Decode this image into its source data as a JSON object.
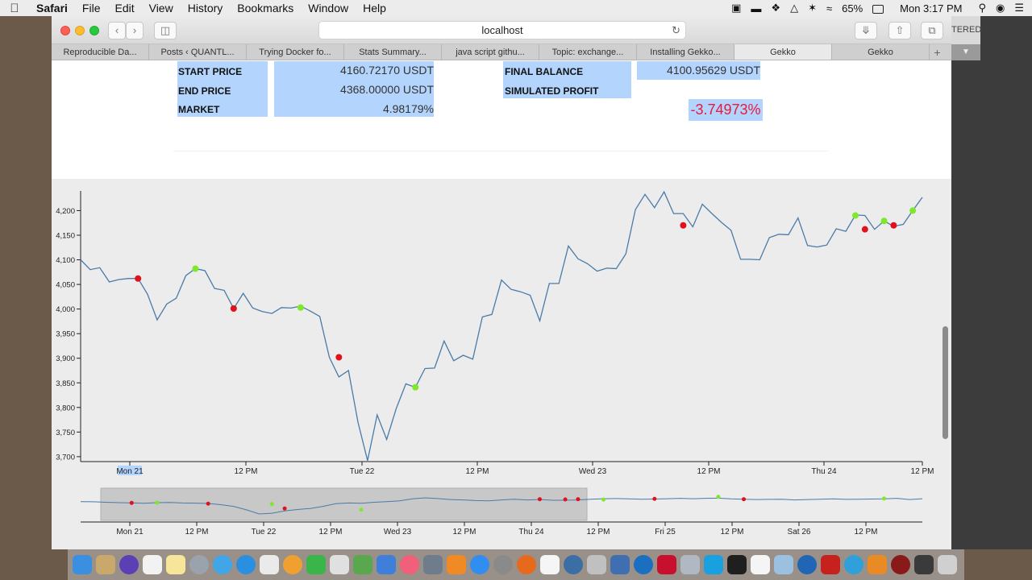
{
  "menubar": {
    "app": "Safari",
    "items": [
      "File",
      "Edit",
      "View",
      "History",
      "Bookmarks",
      "Window",
      "Help"
    ],
    "battery": "65%",
    "clock": "Mon 3:17 PM"
  },
  "browser": {
    "url": "localhost",
    "tabs": [
      "Reproducible Da...",
      "Posts ‹ QUANTL...",
      "Trying Docker fo...",
      "Stats Summary...",
      "java script githu...",
      "Topic: exchange...",
      "Installing Gekko...",
      "Gekko",
      "Gekko"
    ],
    "active_tab_index": 7,
    "side_window_label": "TERED"
  },
  "report": {
    "start_price_label": "START PRICE",
    "start_price": "4160.72170 USDT",
    "end_price_label": "END PRICE",
    "end_price": "4368.00000 USDT",
    "market_label": "MARKET",
    "market": "4.98179%",
    "final_balance_label": "FINAL BALANCE",
    "final_balance": "4100.95629 USDT",
    "simulated_profit_label": "SIMULATED PROFIT",
    "simulated_profit": "-3.74973%",
    "profit_color": "#e8193b"
  },
  "colors": {
    "line": "#4a7ba8",
    "buy": "#7ee82a",
    "sell": "#e0101c",
    "selection": "#b3d4fc"
  },
  "chart_data": [
    {
      "type": "line",
      "ylim": [
        3690,
        4240
      ],
      "yticks": [
        3700,
        3750,
        3800,
        3850,
        3900,
        3950,
        4000,
        4050,
        4100,
        4150,
        4200
      ],
      "xtick_labels": [
        "Mon 21",
        "12 PM",
        "Tue 22",
        "12 PM",
        "Wed 23",
        "12 PM",
        "Thu 24",
        "12 PM"
      ],
      "selected_xtick": "Mon 21",
      "series": [
        {
          "values": [
            4100,
            4080,
            4084,
            4055,
            4060,
            4062,
            4062,
            4030,
            3978,
            4010,
            4022,
            4068,
            4082,
            4078,
            4042,
            4038,
            4001,
            4032,
            4002,
            3995,
            3991,
            4003,
            4002,
            4006,
            3996,
            3985,
            3902,
            3862,
            3875,
            3770,
            3692,
            3785,
            3735,
            3798,
            3848,
            3841,
            3879,
            3880,
            3935,
            3895,
            3906,
            3898,
            3984,
            3989,
            4059,
            4040,
            4035,
            4028,
            3976,
            4052,
            4052,
            4128,
            4102,
            4092,
            4077,
            4083,
            4082,
            4112,
            4202,
            4233,
            4206,
            4238,
            4194,
            4194,
            4167,
            4213,
            4194,
            4176,
            4160,
            4101,
            4101,
            4100,
            4145,
            4152,
            4151,
            4185,
            4129,
            4126,
            4130,
            4163,
            4158,
            4191,
            4190,
            4162,
            4179,
            4168,
            4172,
            4200,
            4227
          ]
        }
      ],
      "buy_points": [
        {
          "index": 12,
          "value": 4082
        },
        {
          "index": 23,
          "value": 4003
        },
        {
          "index": 35,
          "value": 3841
        },
        {
          "index": 81,
          "value": 4190
        },
        {
          "index": 84,
          "value": 4179
        },
        {
          "index": 87,
          "value": 4200
        }
      ],
      "sell_points": [
        {
          "index": 6,
          "value": 4062
        },
        {
          "index": 16,
          "value": 4001
        },
        {
          "index": 27,
          "value": 3902
        },
        {
          "index": 63,
          "value": 4170
        },
        {
          "index": 82,
          "value": 4162
        },
        {
          "index": 85,
          "value": 4170
        }
      ]
    },
    {
      "type": "line",
      "xtick_labels": [
        "Mon 21",
        "12 PM",
        "Tue 22",
        "12 PM",
        "Wed 23",
        "12 PM",
        "Thu 24",
        "12 PM",
        "Fri 25",
        "12 PM",
        "Sat 26",
        "12 PM"
      ],
      "brush_range": [
        "Mon 21",
        "Thu 24"
      ],
      "series": [
        {
          "values": [
            4100,
            4095,
            4080,
            4070,
            4062,
            4050,
            4070,
            4075,
            4060,
            4055,
            4045,
            4010,
            3960,
            3860,
            3740,
            3760,
            3830,
            3870,
            3900,
            3960,
            4040,
            4060,
            4050,
            4080,
            4100,
            4120,
            4180,
            4210,
            4190,
            4160,
            4150,
            4130,
            4120,
            4150,
            4170,
            4150,
            4160,
            4140,
            4140,
            4150,
            4170,
            4185,
            4190,
            4180,
            4170,
            4175,
            4185,
            4195,
            4185,
            4195,
            4200,
            4180,
            4170,
            4160,
            4165,
            4170,
            4150,
            4160,
            4170,
            4180,
            4165,
            4170,
            4175,
            4180,
            4195,
            4160,
            4185
          ]
        }
      ],
      "buy_points": [
        {
          "index": 6,
          "value": 4070
        },
        {
          "index": 15,
          "value": 4030
        },
        {
          "index": 22,
          "value": 3860
        },
        {
          "index": 41,
          "value": 4160
        },
        {
          "index": 50,
          "value": 4240
        },
        {
          "index": 63,
          "value": 4190
        }
      ],
      "sell_points": [
        {
          "index": 4,
          "value": 4062
        },
        {
          "index": 10,
          "value": 4040
        },
        {
          "index": 16,
          "value": 3900
        },
        {
          "index": 36,
          "value": 4170
        },
        {
          "index": 38,
          "value": 4162
        },
        {
          "index": 39,
          "value": 4170
        },
        {
          "index": 45,
          "value": 4180
        },
        {
          "index": 52,
          "value": 4170
        }
      ]
    }
  ]
}
